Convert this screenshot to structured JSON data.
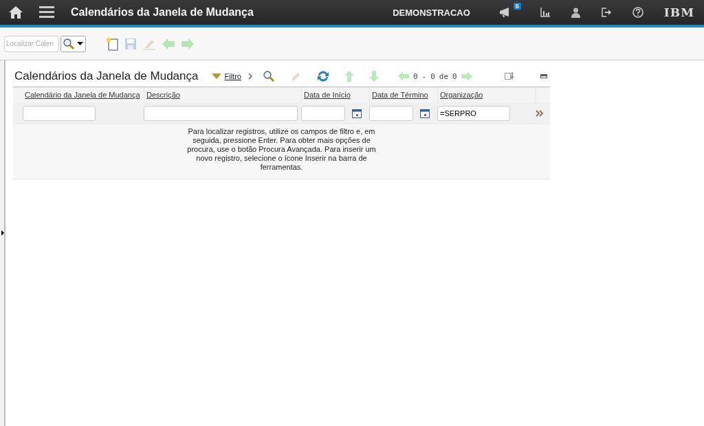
{
  "header": {
    "title": "Calendários da Janela de Mudança",
    "user": "DEMONSTRACAO",
    "notification_count": "5",
    "logo": "IBM"
  },
  "toolbar": {
    "search_placeholder": "Localizar Calen",
    "buttons": [
      {
        "kind": "new",
        "disabled": false
      },
      {
        "kind": "save",
        "disabled": true
      },
      {
        "kind": "clear",
        "disabled": true
      },
      {
        "kind": "prev",
        "disabled": true
      },
      {
        "kind": "next",
        "disabled": true
      }
    ]
  },
  "table": {
    "title": "Calendários da Janela de Mudança",
    "filter_label": "Filtro",
    "tools": [
      {
        "kind": "search",
        "disabled": false
      },
      {
        "kind": "clear",
        "disabled": true
      },
      {
        "kind": "refresh",
        "disabled": false
      },
      {
        "kind": "up",
        "disabled": true
      },
      {
        "kind": "down",
        "disabled": true
      }
    ],
    "pagination": {
      "prev_disabled": true,
      "start": "0",
      "separator": "-",
      "end": "0",
      "of": "de",
      "total": "0",
      "next_disabled": true
    },
    "columns": [
      {
        "label": "Calendário da Janela de Mudança",
        "date": false
      },
      {
        "label": "Descrição",
        "date": false
      },
      {
        "label": "Data de Início",
        "date": true
      },
      {
        "label": "Data de Término",
        "date": true
      },
      {
        "label": "Organização",
        "filter": "=SERPRO",
        "date": false
      }
    ],
    "message": "Para localizar registros, utilize os campos de filtro e, em seguida, pressione Enter. Para obter mais opções de procura, use o botão Procura Avançada. Para inserir um novo registro, selecione o ícone Inserir na barra de ferramentas."
  }
}
